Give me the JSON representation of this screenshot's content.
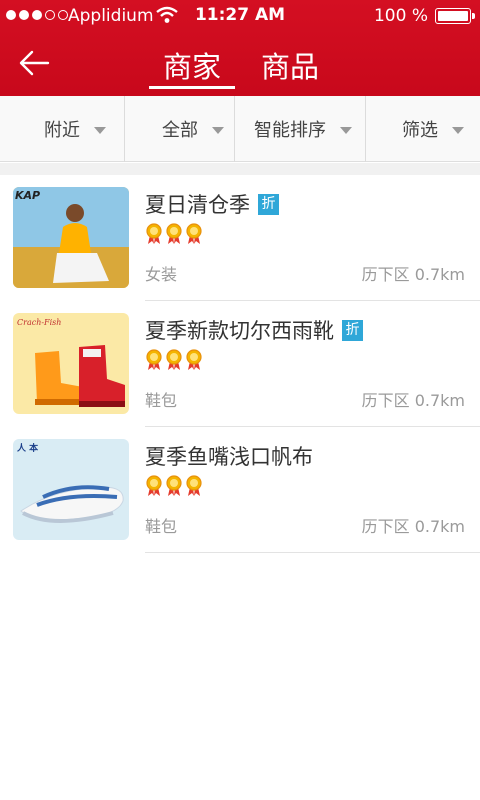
{
  "status_bar": {
    "carrier": "Applidium",
    "time": "11:27 AM",
    "battery": "100 %"
  },
  "header": {
    "tabs": [
      {
        "label": "商家",
        "active": true
      },
      {
        "label": "商品",
        "active": false
      }
    ]
  },
  "filters": [
    {
      "label": "附近"
    },
    {
      "label": "全部"
    },
    {
      "label": "智能排序"
    },
    {
      "label": "筛选"
    }
  ],
  "colors": {
    "brand_red": "#d40f22",
    "badge_blue": "#2fa7d8"
  },
  "items": [
    {
      "title": "夏日清仓季",
      "badge": "折",
      "rating": 3,
      "category": "女装",
      "location": "历下区 0.7km",
      "thumb": "woman-in-yellow-top-photo"
    },
    {
      "title": "夏季新款切尔西雨靴",
      "badge": "折",
      "rating": 3,
      "category": "鞋包",
      "location": "历下区 0.7km",
      "thumb": "rain-boots-photo"
    },
    {
      "title": "夏季鱼嘴浅口帆布",
      "badge": "",
      "rating": 3,
      "category": "鞋包",
      "location": "历下区 0.7km",
      "thumb": "canvas-shoe-photo"
    }
  ]
}
